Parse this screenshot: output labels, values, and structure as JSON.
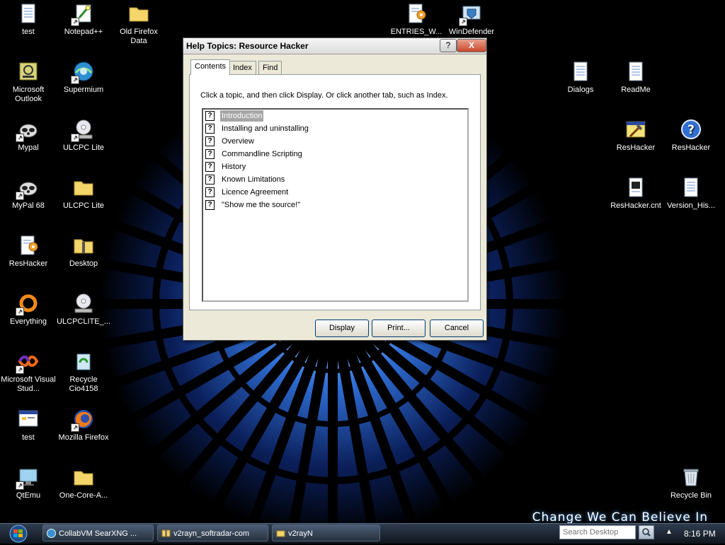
{
  "desktop": {
    "wallpaper_slogan": "Change We Can Believe In",
    "icons": [
      {
        "label": "test",
        "icon": "text-file-icon"
      },
      {
        "label": "Notepad++",
        "icon": "notepad-icon"
      },
      {
        "label": "Old Firefox Data",
        "icon": "folder-icon"
      },
      {
        "label": "ENTRIES_W...",
        "icon": "text-file-gear-icon"
      },
      {
        "label": "WinDefender",
        "icon": "windefender-icon"
      },
      {
        "label": "Microsoft Outlook",
        "icon": "outlook-icon"
      },
      {
        "label": "Supermium",
        "icon": "supermium-icon"
      },
      {
        "label": "Dialogs",
        "icon": "text-file-icon"
      },
      {
        "label": "ReadMe",
        "icon": "text-file-icon"
      },
      {
        "label": "Mypal",
        "icon": "raccoon-icon"
      },
      {
        "label": "ULCPC Lite",
        "icon": "disc-drive-icon"
      },
      {
        "label": "ResHacker",
        "icon": "reshacker-app-icon"
      },
      {
        "label": "ResHacker",
        "icon": "help-circle-icon"
      },
      {
        "label": "MyPal 68",
        "icon": "raccoon-icon"
      },
      {
        "label": "ULCPC Lite",
        "icon": "folder-icon"
      },
      {
        "label": "ResHacker.cnt",
        "icon": "cnt-file-icon"
      },
      {
        "label": "Version_His...",
        "icon": "text-file-icon"
      },
      {
        "label": "ResHacker",
        "icon": "text-file-gear-icon"
      },
      {
        "label": "Desktop",
        "icon": "zip-folder-icon"
      },
      {
        "label": "Everything",
        "icon": "everything-icon"
      },
      {
        "label": "ULCPCLITE_...",
        "icon": "disc-drive-icon"
      },
      {
        "label": "Microsoft Visual Stud...",
        "icon": "visual-studio-icon"
      },
      {
        "label": "Recycle Cio4158",
        "icon": "recycle-icon"
      },
      {
        "label": "test",
        "icon": "app-window-icon"
      },
      {
        "label": "Mozilla Firefox",
        "icon": "firefox-icon"
      },
      {
        "label": "QtEmu",
        "icon": "qtemu-icon"
      },
      {
        "label": "One-Core-A...",
        "icon": "folder-icon"
      },
      {
        "label": "Recycle Bin",
        "icon": "recycle-bin-icon"
      }
    ]
  },
  "dialog": {
    "title": "Help Topics: Resource Hacker",
    "help_label": "?",
    "close_label": "X",
    "tabs": [
      "Contents",
      "Index",
      "Find"
    ],
    "instruction": "Click a topic, and then click Display. Or click another tab, such as Index.",
    "topics": [
      "Introduction",
      "Installing and uninstalling",
      "Overview",
      "Commandline Scripting",
      "History",
      "Known Limitations",
      "Licence Agreement",
      "\"Show me the source!\""
    ],
    "selected_topic": "Introduction",
    "buttons": {
      "display": "Display",
      "print": "Print...",
      "cancel": "Cancel"
    }
  },
  "taskbar": {
    "tasks": [
      "CollabVM SearXNG ...",
      "v2rayn_softradar-com",
      "v2rayN"
    ],
    "search_placeholder": "Search Desktop",
    "clock": "8:16 PM"
  }
}
